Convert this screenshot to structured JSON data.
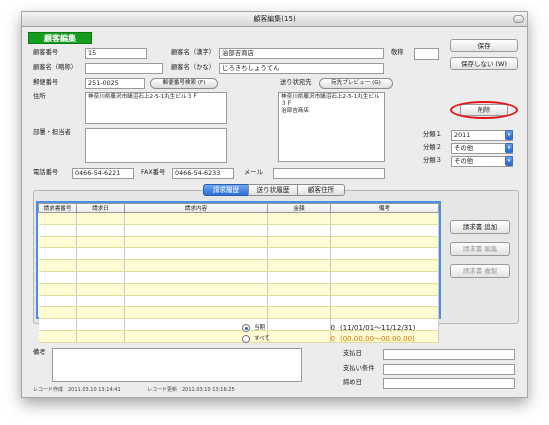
{
  "window": {
    "title": "顧客編集(15)"
  },
  "header": {
    "section_title": "顧客編集"
  },
  "fields": {
    "customer_no": {
      "label": "顧客番号",
      "value": "15"
    },
    "customer_short": {
      "label": "顧客名（略称）",
      "value": ""
    },
    "customer_name_kanji": {
      "label": "顧客名（漢字）",
      "value": "治部吉商店"
    },
    "customer_name_kana": {
      "label": "顧客名（かな）",
      "value": "じろきちしょうてん"
    },
    "honorific": {
      "label": "敬称",
      "value": ""
    },
    "postal": {
      "label": "郵便番号",
      "value": "251-0025"
    },
    "address": {
      "label": "住所",
      "value": "神奈川県藤沢市鵠沼石上2-5-1丸生ビル３Ｆ"
    },
    "dept": {
      "label": "部署・担当者",
      "value": ""
    },
    "phone": {
      "label": "電話番号",
      "value": "0466-54-6221"
    },
    "fax": {
      "label": "FAX番号",
      "value": "0466-54-6233"
    },
    "mail": {
      "label": "メール",
      "value": ""
    },
    "send_to": {
      "label": "送り状宛先",
      "value": "神奈川県藤沢市鵠沼石上2-5-1丸生ビル\n３Ｆ\n治部吉商店"
    }
  },
  "buttons": {
    "postal_search": "郵便番号検索 (F)",
    "address_preview": "宛先プレビュー (G)",
    "save": "保存",
    "no_save": "保存しない (W)",
    "delete": "削除",
    "invoice_add": "請求書 追加",
    "invoice_edit": "請求書 編集",
    "invoice_copy": "請求書 複製"
  },
  "categories": [
    {
      "label": "分類１",
      "value": "2011"
    },
    {
      "label": "分類２",
      "value": "その他"
    },
    {
      "label": "分類３",
      "value": "その他"
    }
  ],
  "tabs": [
    {
      "label": "請求履歴",
      "active": true
    },
    {
      "label": "送り状履歴",
      "active": false
    },
    {
      "label": "顧客住所",
      "active": false
    }
  ],
  "table": {
    "columns": [
      "請求書番号",
      "請求日",
      "請求内容",
      "金額",
      "備考"
    ],
    "rows": 11
  },
  "filter": {
    "current": {
      "label": "当期",
      "count": "0",
      "range": "(11/01/01〜11/12/31)"
    },
    "all": {
      "label": "すべて",
      "count": "0",
      "range": "(00.00.00〜00.00.00)"
    }
  },
  "footer": {
    "memo_label": "備考",
    "pay_date_label": "支払日",
    "pay_terms_label": "支払い条件",
    "close_date_label": "締め日",
    "created": "レコード作成　2011.03.10 13:14:41",
    "updated": "レコード更新　2011.03.10 13:16:25"
  },
  "colors": {
    "header_green": "#169c1f",
    "accent_blue": "#2c6fd6",
    "annotation_red": "#e0151b",
    "row_yellow": "#fffbd2"
  }
}
